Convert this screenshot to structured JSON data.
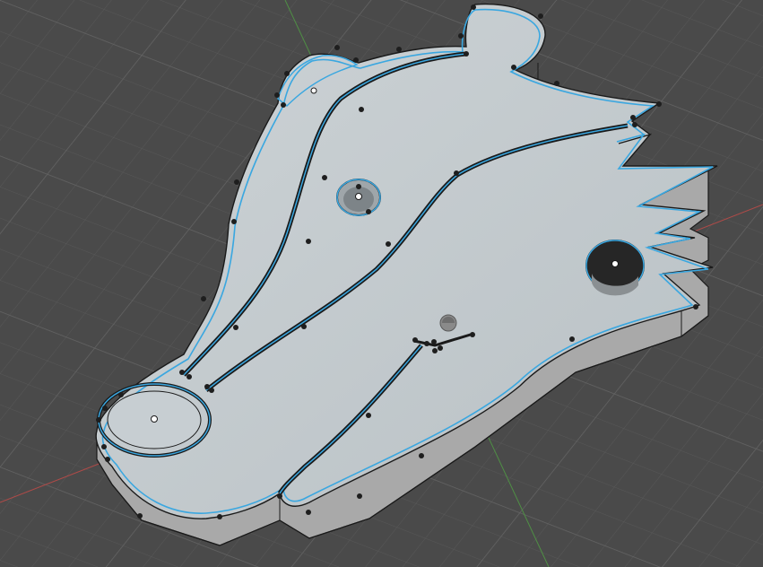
{
  "viewport": {
    "background": "#4a4a4a",
    "grid_minor_color": "#565656",
    "grid_major_color": "#626262",
    "x_axis_color": "#b04a48",
    "y_axis_color": "#4f8f45"
  },
  "model": {
    "top_face_color": "#c4cbcf",
    "side_face_color": "#a9a9a9",
    "edge_color": "#1a1a1a",
    "selection_color": "#3aa7e0"
  },
  "origin_marker": {
    "color": "#8a8a8a"
  },
  "selection_vertices": {
    "vertex_color": "#1e1e1e",
    "center_point_color": "#ffffff"
  }
}
